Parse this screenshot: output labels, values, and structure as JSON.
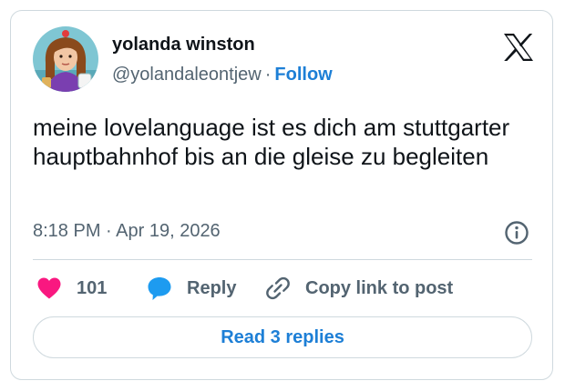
{
  "author": {
    "name": "yolanda winston",
    "handle": "@yolandaleontjew",
    "separator": "·",
    "follow_label": "Follow",
    "avatar_icon": "avatar-cartoon-woman"
  },
  "brand": {
    "logo_icon": "x-logo-icon"
  },
  "tweet": {
    "text": "meine lovelanguage ist es dich am stuttgarter hauptbahnhof bis an die gleise zu begleiten",
    "timestamp": "8:18 PM · Apr 19, 2026"
  },
  "actions": {
    "likes_count": "101",
    "reply_label": "Reply",
    "copy_link_label": "Copy link to post"
  },
  "read_replies_label": "Read 3 replies",
  "colors": {
    "heart": "#f91880",
    "reply_bubble": "#1d9bf0",
    "link_blue": "#1d7fd6",
    "text_primary": "#0f1419",
    "text_secondary": "#536471",
    "border": "#cfd9de"
  }
}
